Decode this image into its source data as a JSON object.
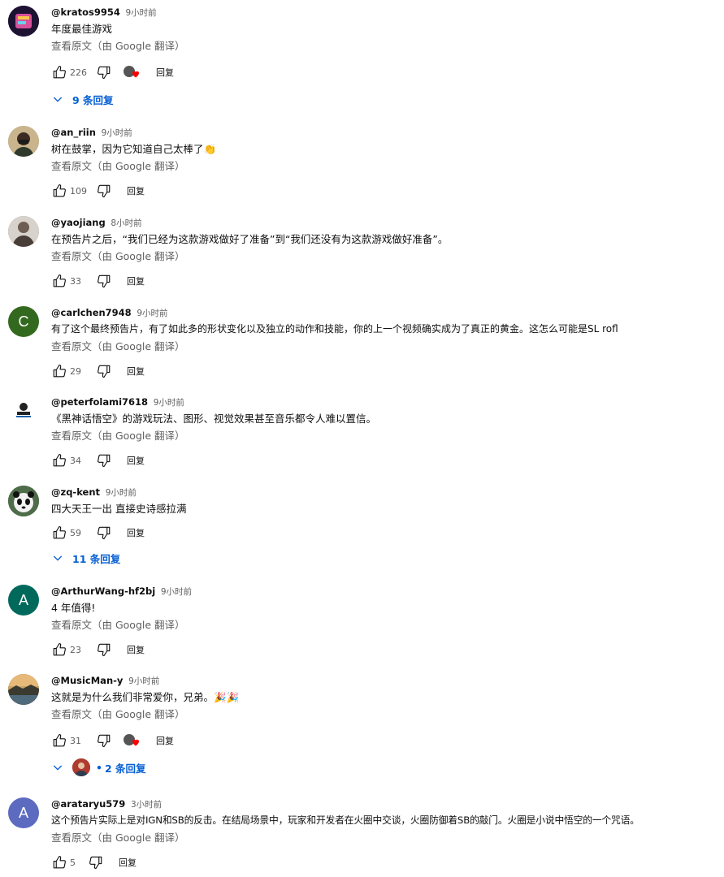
{
  "ui": {
    "translate_label": "查看原文（由 Google 翻译）",
    "reply_label": "回复"
  },
  "colors": {
    "link_blue": "#065fd4",
    "meta_gray": "#606060",
    "heart_red": "#ff0000"
  },
  "comments": [
    {
      "author": "@kratos9954",
      "time": "9小时前",
      "text": "年度最佳游戏",
      "likes": "226",
      "avatar_color": "#2b1c3b",
      "hearted": true,
      "replies": "9 条回复"
    },
    {
      "author": "@an_riin",
      "time": "9小时前",
      "text": "树在鼓掌，因为它知道自己太棒了👏",
      "likes": "109",
      "avatar_color": "#b8a27d",
      "hearted": false,
      "replies": ""
    },
    {
      "author": "@yaojiang",
      "time": "8小时前",
      "text": "在预告片之后，“我们已经为这款游戏做好了准备”到“我们还没有为这款游戏做好准备”。",
      "likes": "33",
      "avatar_color": "#8a7f78",
      "hearted": false,
      "replies": ""
    },
    {
      "author": "@carlchen7948",
      "time": "9小时前",
      "text": "有了这个最终预告片，有了如此多的形状变化以及独立的动作和技能，你的上一个视频确实成为了真正的黄金。这怎么可能是SL rofl",
      "likes": "29",
      "avatar_color": "#33691e",
      "avatar_letter": "C",
      "hearted": false,
      "replies": ""
    },
    {
      "author": "@peterfolami7618",
      "time": "9小时前",
      "text": "《黑神话悟空》的游戏玩法、图形、视觉效果甚至音乐都令人难以置信。",
      "likes": "34",
      "avatar_color": "#ffffff",
      "hearted": false,
      "replies": ""
    },
    {
      "author": "@zq-kent",
      "time": "9小时前",
      "text": "四大天王一出 直接史诗感拉满",
      "likes": "59",
      "avatar_color": "#4a6b46",
      "hearted": false,
      "replies": "11 条回复"
    },
    {
      "author": "@ArthurWang-hf2bj",
      "time": "9小时前",
      "text": "4 年值得!",
      "likes": "23",
      "avatar_color": "#00695c",
      "avatar_letter": "A",
      "hearted": false,
      "replies": ""
    },
    {
      "author": "@MusicMan-y",
      "time": "9小时前",
      "text": "这就是为什么我们非常爱你，兄弟。🎉🎉",
      "likes": "31",
      "avatar_color": "#6b5a45",
      "hearted": true,
      "replies": "2 条回复"
    },
    {
      "author": "@arataryu579",
      "time": "3小时前",
      "text": "这个预告片实际上是对IGN和SB的反击。在结局场景中，玩家和开发者在火圈中交谈，火圈防御着SB的敲门。火圈是小说中悟空的一个咒语。",
      "likes": "5",
      "avatar_color": "#5c6bc0",
      "avatar_letter": "A",
      "hearted": false,
      "replies": ""
    }
  ]
}
